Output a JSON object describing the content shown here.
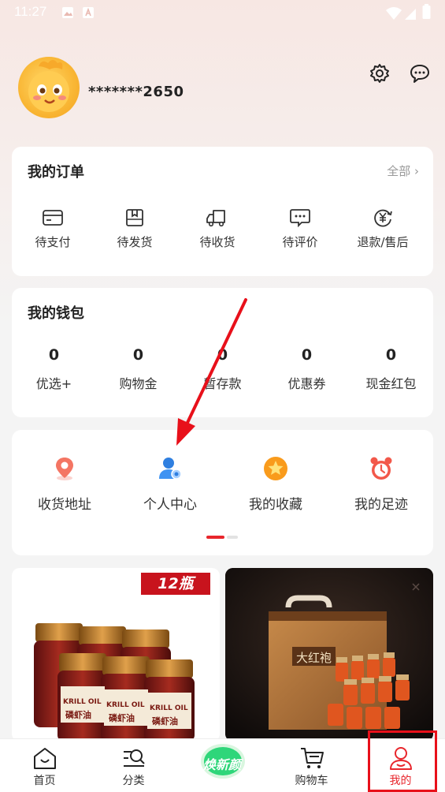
{
  "status_bar": {
    "time": "11:27"
  },
  "profile": {
    "username": "*******2650"
  },
  "orders": {
    "title": "我的订单",
    "all_label": "全部",
    "items": [
      {
        "label": "待支付",
        "icon": "wallet-card-icon"
      },
      {
        "label": "待发货",
        "icon": "package-box-icon"
      },
      {
        "label": "待收货",
        "icon": "delivery-truck-icon"
      },
      {
        "label": "待评价",
        "icon": "comment-bubble-icon"
      },
      {
        "label": "退款/售后",
        "icon": "refund-yen-icon"
      }
    ]
  },
  "wallet": {
    "title": "我的钱包",
    "items": [
      {
        "value": "0",
        "label": "优选+"
      },
      {
        "value": "0",
        "label": "购物金"
      },
      {
        "value": "0",
        "label": "暂存款"
      },
      {
        "value": "0",
        "label": "优惠券"
      },
      {
        "value": "0",
        "label": "现金红包"
      }
    ]
  },
  "services": {
    "items": [
      {
        "label": "收货地址",
        "icon": "location-pin-icon"
      },
      {
        "label": "个人中心",
        "icon": "user-profile-icon"
      },
      {
        "label": "我的收藏",
        "icon": "star-favorite-icon"
      },
      {
        "label": "我的足迹",
        "icon": "alarm-clock-icon"
      }
    ]
  },
  "products": [
    {
      "badge": "12瓶",
      "bottle_label": "KRILL OIL",
      "bottle_label_cn": "磷虾油"
    },
    {
      "box_label": "大红袍"
    }
  ],
  "tabbar": {
    "items": [
      {
        "label": "首页",
        "icon": "home-icon"
      },
      {
        "label": "分类",
        "icon": "category-search-icon"
      },
      {
        "label": "焕新颜",
        "icon": "promo-logo-icon"
      },
      {
        "label": "购物车",
        "icon": "cart-icon"
      },
      {
        "label": "我的",
        "icon": "me-user-icon"
      }
    ],
    "active_index": 4
  },
  "colors": {
    "accent": "#e8262c",
    "badge": "#c8131d",
    "highlight": "#e8101a"
  }
}
